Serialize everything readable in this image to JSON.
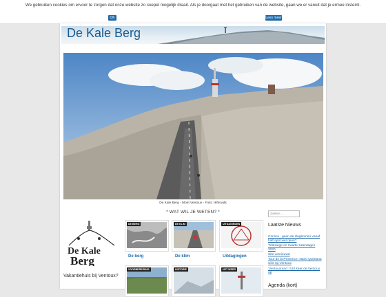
{
  "cookie": {
    "text": "We gebruiken cookies om ervoor te zorgen dat onze website zo soepel mogelijk draait. Als je doorgaat met het gebruiken van de website, gaan we er vanuit dat je ermee instemt.",
    "ok_label": "OK",
    "more_label": "Lees meer"
  },
  "site": {
    "title": "De Kale Berg"
  },
  "hero": {
    "caption": "De Kale Berg - Mont Ventoux - Foto: Hifiroads"
  },
  "main": {
    "section_title": "* WAT WIL JE WETEN? *",
    "logo_text_line1": "De Kale",
    "logo_text_line2": "Berg",
    "tiles": [
      {
        "tag": "DE BERG",
        "link": "De berg"
      },
      {
        "tag": "DE KLIM",
        "link": "De klim"
      },
      {
        "tag": "UITDAGINGEN",
        "link": "Uitdagingen"
      },
      {
        "tag": "VOORBEREIDING",
        "link": ""
      },
      {
        "tag": "HISTORIE",
        "link": ""
      },
      {
        "tag": "HET WEER",
        "link": ""
      }
    ],
    "vakantiehuis": "Vakantiehuis bij Ventoux?"
  },
  "sidebar": {
    "search_placeholder": "Zoeken ...",
    "news_title": "Laatste Nieuws",
    "news": [
      "Corona - gaan de slagbomen vanaf half april wel open?",
      "Télésiège en zwarte zaterdagen 2020",
      "Site vernieuwd",
      "Tour de la Provence: Nairo Quintana wint op Ventoux",
      "'Ventouxman': 610 keer de Ventoux op"
    ],
    "agenda_title": "Agenda (kort)"
  },
  "colors": {
    "accent": "#1e6aa8",
    "title_blue": "#1a5a8e"
  }
}
